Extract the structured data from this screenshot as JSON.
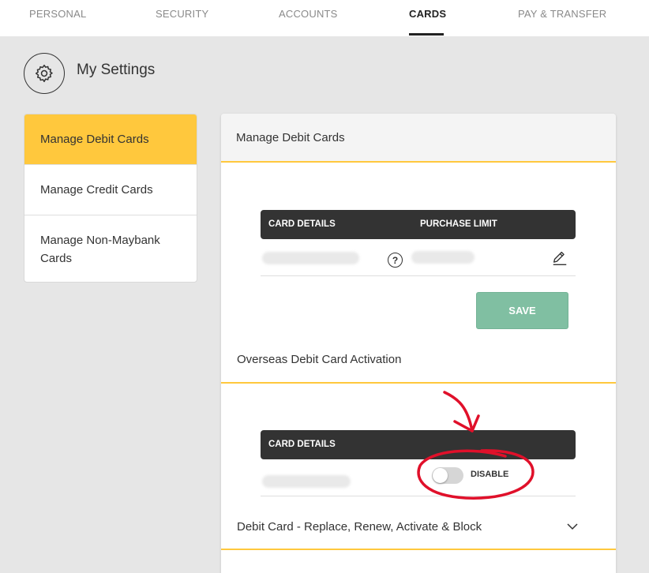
{
  "nav": {
    "tabs": [
      {
        "label": "PERSONAL"
      },
      {
        "label": "SECURITY"
      },
      {
        "label": "ACCOUNTS"
      },
      {
        "label": "CARDS"
      },
      {
        "label": "PAY & TRANSFER"
      }
    ],
    "active_tab": "CARDS"
  },
  "header": {
    "title": "My Settings",
    "icon": "gear-icon"
  },
  "sidebar": {
    "items": [
      {
        "label": "Manage Debit Cards"
      },
      {
        "label": "Manage Credit Cards"
      },
      {
        "label": "Manage Non-Maybank Cards"
      }
    ],
    "active_item": "Manage Debit Cards"
  },
  "panel": {
    "title": "Manage Debit Cards",
    "limit_table": {
      "col_card_details": "CARD DETAILS",
      "col_purchase_limit": "PURCHASE LIMIT"
    },
    "save_label": "SAVE",
    "overseas": {
      "title": "Overseas Debit Card Activation",
      "col_card_details": "CARD DETAILS",
      "toggle_label": "DISABLE",
      "toggle_on": false
    },
    "replace_section": {
      "title": "Debit Card - Replace, Renew, Activate & Block"
    }
  },
  "colors": {
    "accent": "#ffc83d",
    "table_header": "#333333",
    "save_button": "#80bfa2",
    "annotation": "#e0102a"
  }
}
